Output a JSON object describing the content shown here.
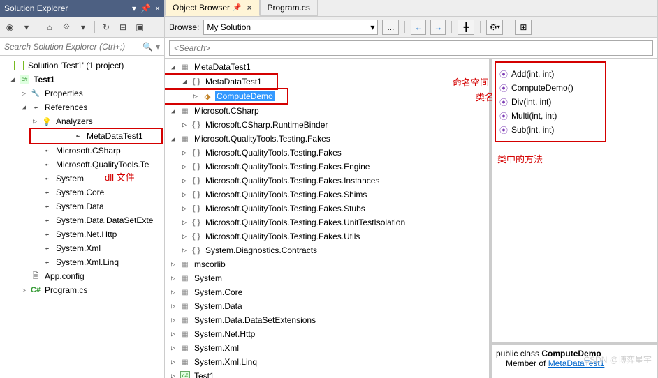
{
  "se": {
    "title": "Solution Explorer",
    "search_placeholder": "Search Solution Explorer (Ctrl+;)",
    "solution": "Solution 'Test1' (1 project)",
    "project": "Test1",
    "nodes": {
      "properties": "Properties",
      "references": "References",
      "analyzers": "Analyzers",
      "refs": [
        "MetaDataTest1",
        "Microsoft.CSharp",
        "Microsoft.QualityTools.Te",
        "System",
        "System.Core",
        "System.Data",
        "System.Data.DataSetExte",
        "System.Net.Http",
        "System.Xml",
        "System.Xml.Linq"
      ],
      "appconfig": "App.config",
      "programcs": "Program.cs"
    },
    "anno_dll": "dll 文件"
  },
  "ob": {
    "tab1": "Object Browser",
    "tab2": "Program.cs",
    "browse_label": "Browse:",
    "browse_value": "My Solution",
    "search_placeholder": "<Search>",
    "anno_ns": "命名空间",
    "anno_class": "类名",
    "anno_methods": "类中的方法",
    "tree": {
      "asm1": "MetaDataTest1",
      "ns1": "MetaDataTest1",
      "class1": "ComputeDemo",
      "asm2": "Microsoft.CSharp",
      "ns2_1": "Microsoft.CSharp.RuntimeBinder",
      "asm3": "Microsoft.QualityTools.Testing.Fakes",
      "ns3": [
        "Microsoft.QualityTools.Testing.Fakes",
        "Microsoft.QualityTools.Testing.Fakes.Engine",
        "Microsoft.QualityTools.Testing.Fakes.Instances",
        "Microsoft.QualityTools.Testing.Fakes.Shims",
        "Microsoft.QualityTools.Testing.Fakes.Stubs",
        "Microsoft.QualityTools.Testing.Fakes.UnitTestIsolation",
        "Microsoft.QualityTools.Testing.Fakes.Utils",
        "System.Diagnostics.Contracts"
      ],
      "rest": [
        "mscorlib",
        "System",
        "System.Core",
        "System.Data",
        "System.Data.DataSetExtensions",
        "System.Net.Http",
        "System.Xml",
        "System.Xml.Linq",
        "Test1"
      ]
    },
    "members": [
      "Add(int, int)",
      "ComputeDemo()",
      "Div(int, int)",
      "Multi(int, int)",
      "Sub(int, int)"
    ],
    "detail_prefix": "public class ",
    "detail_class": "ComputeDemo",
    "detail_member": "Member of ",
    "detail_link": "MetaDataTest1"
  },
  "watermark": "CSDN @博弈星宇"
}
